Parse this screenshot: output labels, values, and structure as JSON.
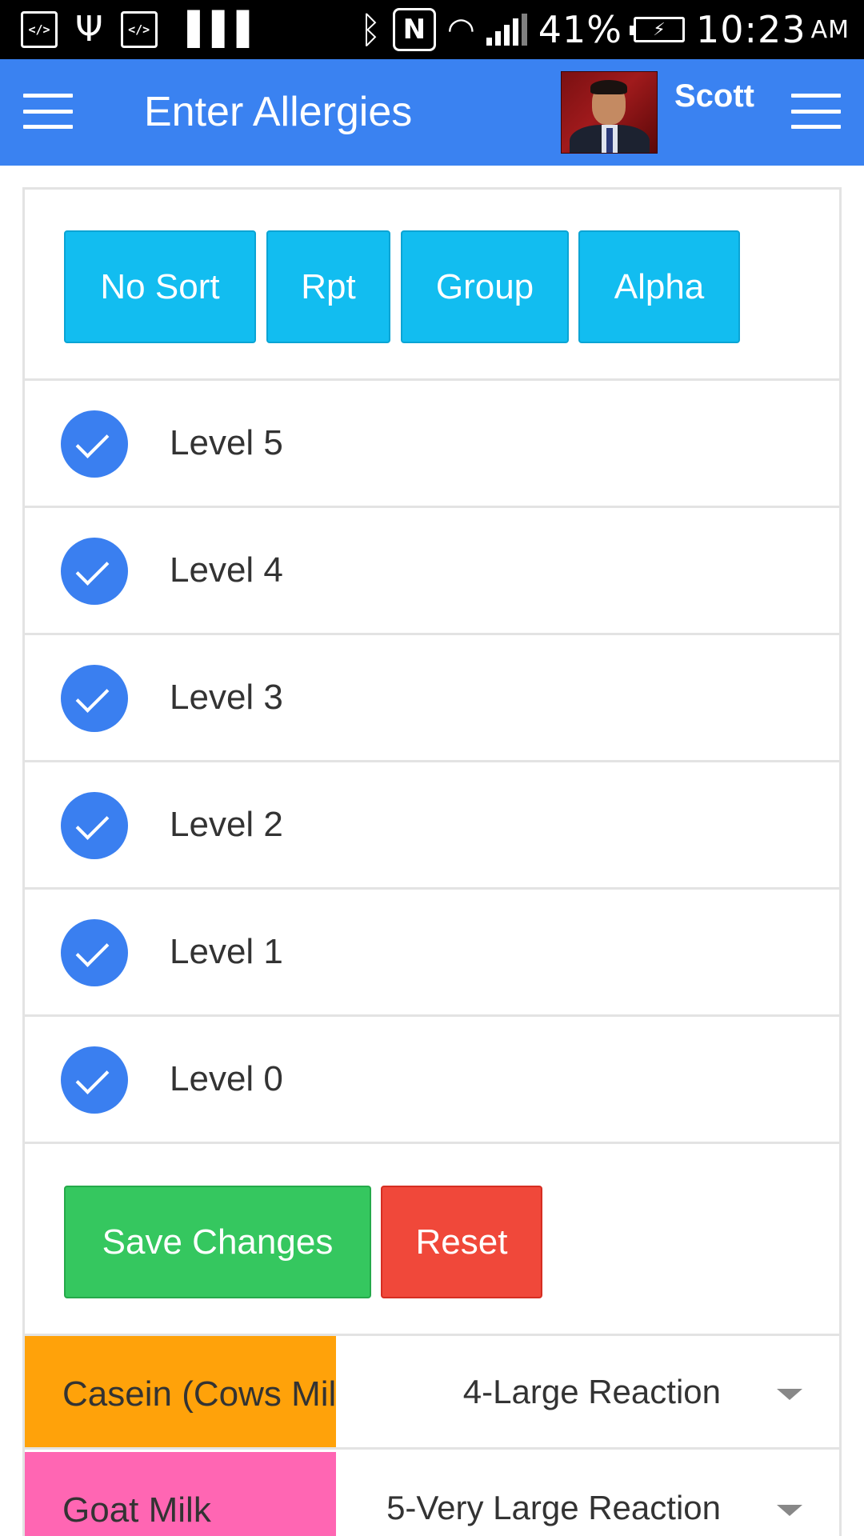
{
  "status_bar": {
    "left_icons": [
      "code-icon",
      "usb-icon",
      "code-icon",
      "barcode-icon"
    ],
    "right_icons": [
      "bluetooth-icon",
      "nfc-icon",
      "wifi-icon",
      "signal-icon",
      "battery-charging-icon"
    ],
    "battery_percent": "41%",
    "time": "10:23",
    "ampm": "AM"
  },
  "header": {
    "title": "Enter Allergies",
    "user_name": "Scott",
    "bg_color": "#3a82f1"
  },
  "sort_buttons": {
    "no_sort": "No Sort",
    "rpt": "Rpt",
    "group": "Group",
    "alpha": "Alpha",
    "color": "#12bdf0"
  },
  "levels": [
    {
      "label": "Level 5",
      "checked": true
    },
    {
      "label": "Level 4",
      "checked": true
    },
    {
      "label": "Level 3",
      "checked": true
    },
    {
      "label": "Level 2",
      "checked": true
    },
    {
      "label": "Level 1",
      "checked": true
    },
    {
      "label": "Level 0",
      "checked": true
    }
  ],
  "actions": {
    "save_label": "Save Changes",
    "reset_label": "Reset",
    "save_color": "#35c75f",
    "reset_color": "#f0483a"
  },
  "allergies": [
    {
      "name": "Casein (Cows Milk)",
      "reaction": "4-Large Reaction",
      "color": "#ffa20a"
    },
    {
      "name": "Goat Milk",
      "reaction": "5-Very Large Reaction",
      "color": "#ff66b3"
    }
  ]
}
